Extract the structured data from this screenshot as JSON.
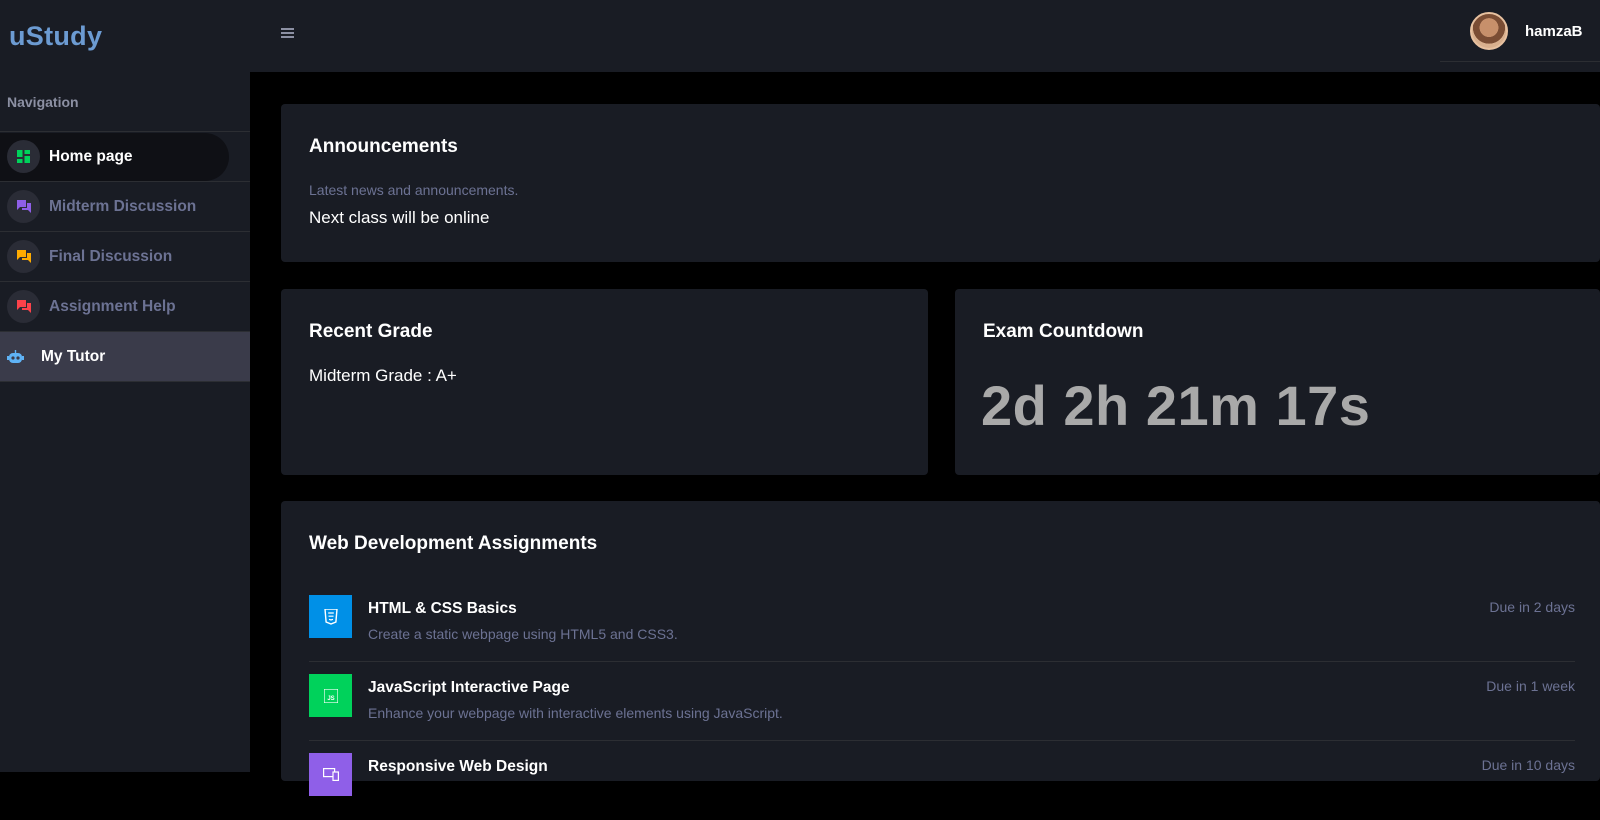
{
  "brand": {
    "name": "uStudy",
    "color": "#6c9bd2"
  },
  "header": {
    "menu_icon": "hamburger-icon",
    "username": "hamzaB"
  },
  "sidebar": {
    "heading": "Navigation",
    "items": [
      {
        "label": "Home page",
        "icon": "dashboard-icon",
        "icon_color": "#00d25b",
        "active": true
      },
      {
        "label": "Midterm Discussion",
        "icon": "chat-icon",
        "icon_color": "#8f5fe8"
      },
      {
        "label": "Final Discussion",
        "icon": "chat-icon",
        "icon_color": "#ffab00"
      },
      {
        "label": "Assignment Help",
        "icon": "chat-icon",
        "icon_color": "#fc424a"
      },
      {
        "label": "My Tutor",
        "icon": "robot-icon",
        "icon_color": "#5fb3f6"
      }
    ]
  },
  "announcements": {
    "title": "Announcements",
    "description": "Latest news and announcements.",
    "message": "Next class will be online"
  },
  "recent_grade": {
    "title": "Recent Grade",
    "value": "Midterm Grade : A+"
  },
  "exam_countdown": {
    "title": "Exam Countdown",
    "timer": "2d 2h 21m 17s"
  },
  "assignments": {
    "title": "Web Development Assignments",
    "items": [
      {
        "title": "HTML & CSS Basics",
        "description": "Create a static webpage using HTML5 and CSS3.",
        "due": "Due in 2 days",
        "icon": "html5-icon",
        "color": "#0090e7"
      },
      {
        "title": "JavaScript Interactive Page",
        "description": "Enhance your webpage with interactive elements using JavaScript.",
        "due": "Due in 1 week",
        "icon": "javascript-icon",
        "color": "#00d25b"
      },
      {
        "title": "Responsive Web Design",
        "description": "",
        "due": "Due in 10 days",
        "icon": "responsive-icon",
        "color": "#8f5fe8"
      }
    ]
  }
}
